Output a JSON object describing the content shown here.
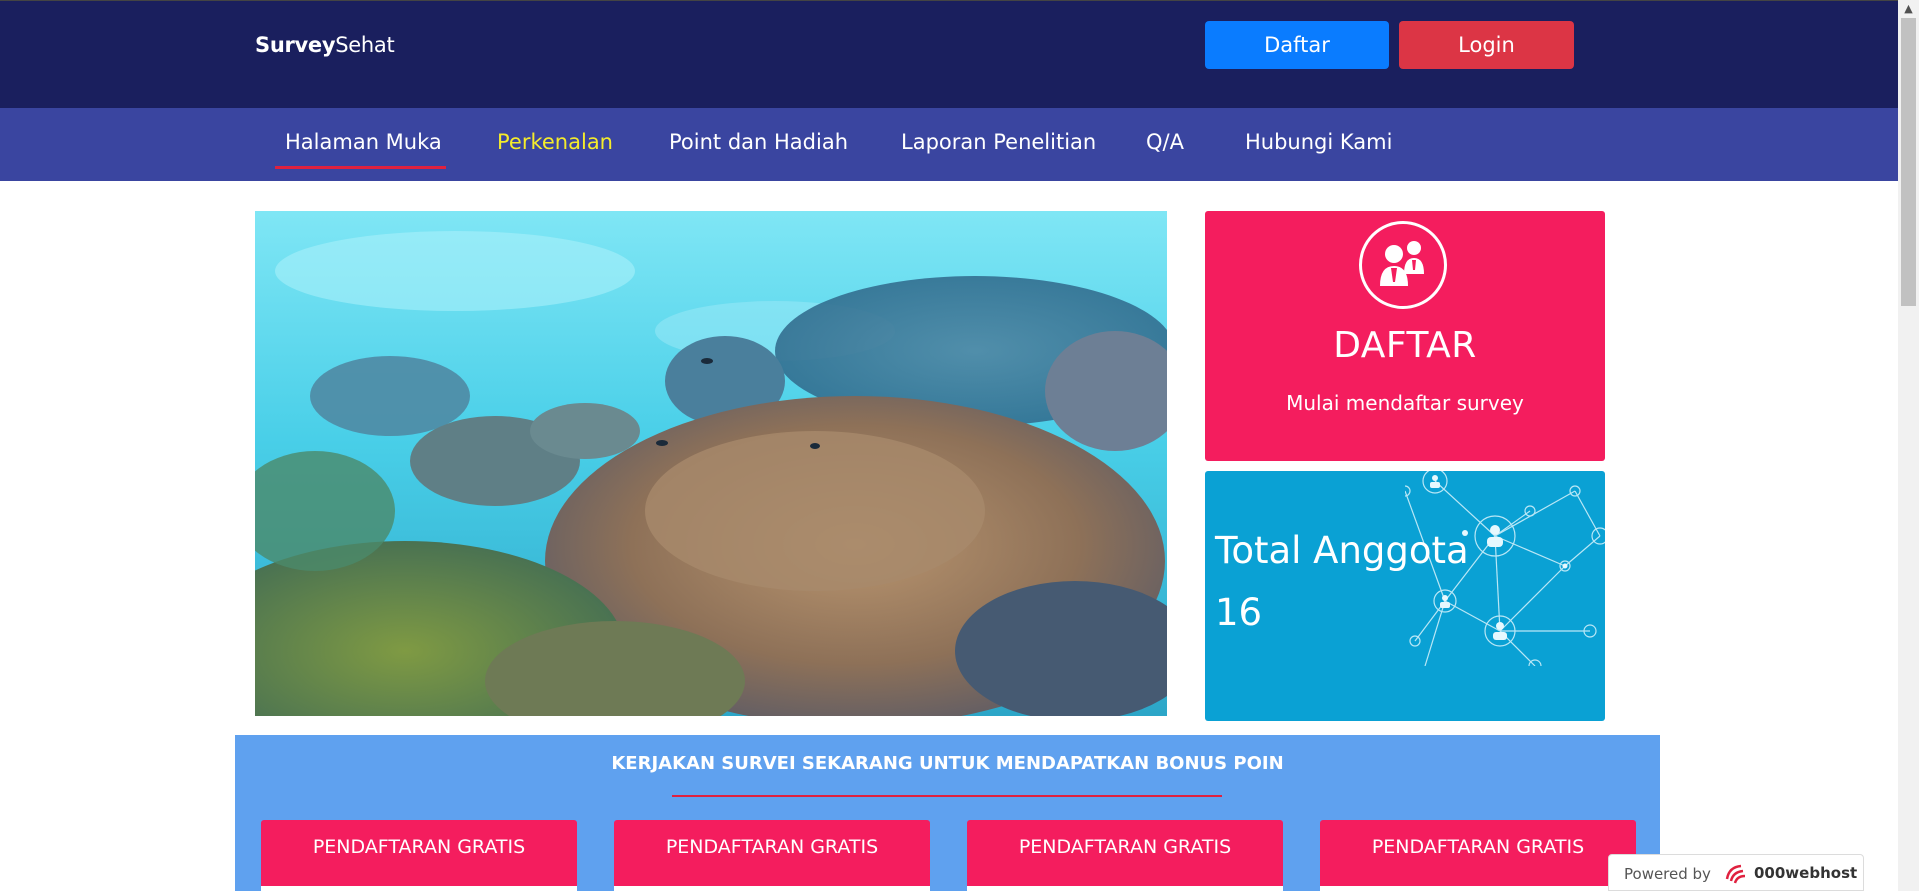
{
  "header": {
    "brand_bold": "Survey",
    "brand_light": "Sehat",
    "daftar_label": "Daftar",
    "login_label": "Login"
  },
  "nav": {
    "items": [
      {
        "label": "Halaman Muka"
      },
      {
        "label": "Perkenalan"
      },
      {
        "label": "Point dan Hadiah"
      },
      {
        "label": "Laporan Penelitian"
      },
      {
        "label": "Q/A"
      },
      {
        "label": "Hubungi Kami"
      }
    ],
    "active_index": 0,
    "highlight_index": 1
  },
  "cards": {
    "daftar_title": "DAFTAR",
    "daftar_subtitle": "Mulai mendaftar survey",
    "anggota_label": "Total Anggota",
    "anggota_value": "16"
  },
  "promo": {
    "title": "KERJAKAN SURVEI SEKARANG UNTUK MENDAPATKAN BONUS POIN",
    "buttons": [
      {
        "label": "PENDAFTARAN GRATIS"
      },
      {
        "label": "PENDAFTARAN GRATIS"
      },
      {
        "label": "PENDAFTARAN GRATIS"
      },
      {
        "label": "PENDAFTARAN GRATIS"
      }
    ]
  },
  "footer": {
    "powered_label": "Powered by",
    "host_name": "000webhost"
  },
  "colors": {
    "topbar": "#1a1f5e",
    "navbar": "#3a45a0",
    "nav_highlight": "#f5ec2b",
    "daftar_card": "#f41d5e",
    "anggota_card": "#0aa1d4",
    "promo_bg": "#5fa1ef",
    "btn_daftar": "#0a7cff",
    "btn_login": "#dc3545"
  }
}
